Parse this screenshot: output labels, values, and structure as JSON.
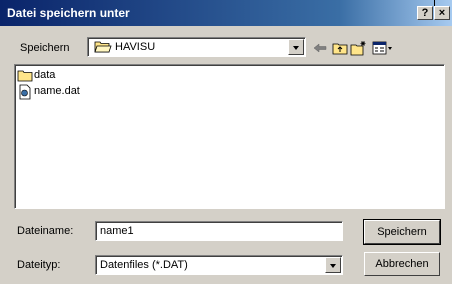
{
  "window": {
    "title": "Datei speichern unter",
    "help_label": "?",
    "close_label": "×"
  },
  "save_in": {
    "label": "Speichern",
    "folder": "HAVISU",
    "icons": [
      "back-arrow-icon",
      "up-folder-icon",
      "new-folder-icon",
      "view-menu-icon"
    ]
  },
  "files": [
    {
      "name": "data",
      "icon": "folder-icon"
    },
    {
      "name": "name.dat",
      "icon": "dat-file-icon"
    }
  ],
  "filename": {
    "label": "Dateiname:",
    "value": "name1"
  },
  "filetype": {
    "label": "Dateityp:",
    "value": "Datenfiles (*.DAT)"
  },
  "buttons": {
    "save": "Speichern",
    "cancel": "Abbrechen"
  },
  "colors": {
    "title_bar": "#0a246a",
    "face": "#d4d0c8"
  }
}
